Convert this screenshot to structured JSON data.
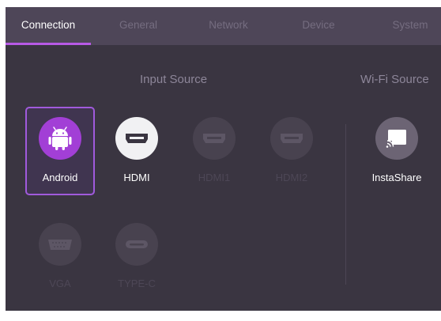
{
  "tabs": [
    {
      "label": "Connection",
      "active": true
    },
    {
      "label": "General",
      "active": false
    },
    {
      "label": "Network",
      "active": false
    },
    {
      "label": "Device",
      "active": false
    },
    {
      "label": "System",
      "active": false
    }
  ],
  "input_source": {
    "title": "Input Source",
    "items": [
      {
        "label": "Android",
        "icon": "android-icon",
        "state": "selected"
      },
      {
        "label": "HDMI",
        "icon": "hdmi-port-icon",
        "state": "enabled"
      },
      {
        "label": "HDMI1",
        "icon": "hdmi-port-icon",
        "state": "disabled"
      },
      {
        "label": "HDMI2",
        "icon": "hdmi-port-icon",
        "state": "disabled"
      },
      {
        "label": "VGA",
        "icon": "vga-port-icon",
        "state": "disabled"
      },
      {
        "label": "TYPE-C",
        "icon": "usb-c-port-icon",
        "state": "disabled"
      }
    ]
  },
  "wifi_source": {
    "title": "Wi-Fi Source",
    "items": [
      {
        "label": "InstaShare",
        "icon": "cast-screen-icon",
        "state": "enabled"
      }
    ]
  },
  "colors": {
    "background": "#3a3541",
    "tab_bar": "#4e4658",
    "accent": "#b85ae6",
    "android_circle": "#a23fd6"
  }
}
